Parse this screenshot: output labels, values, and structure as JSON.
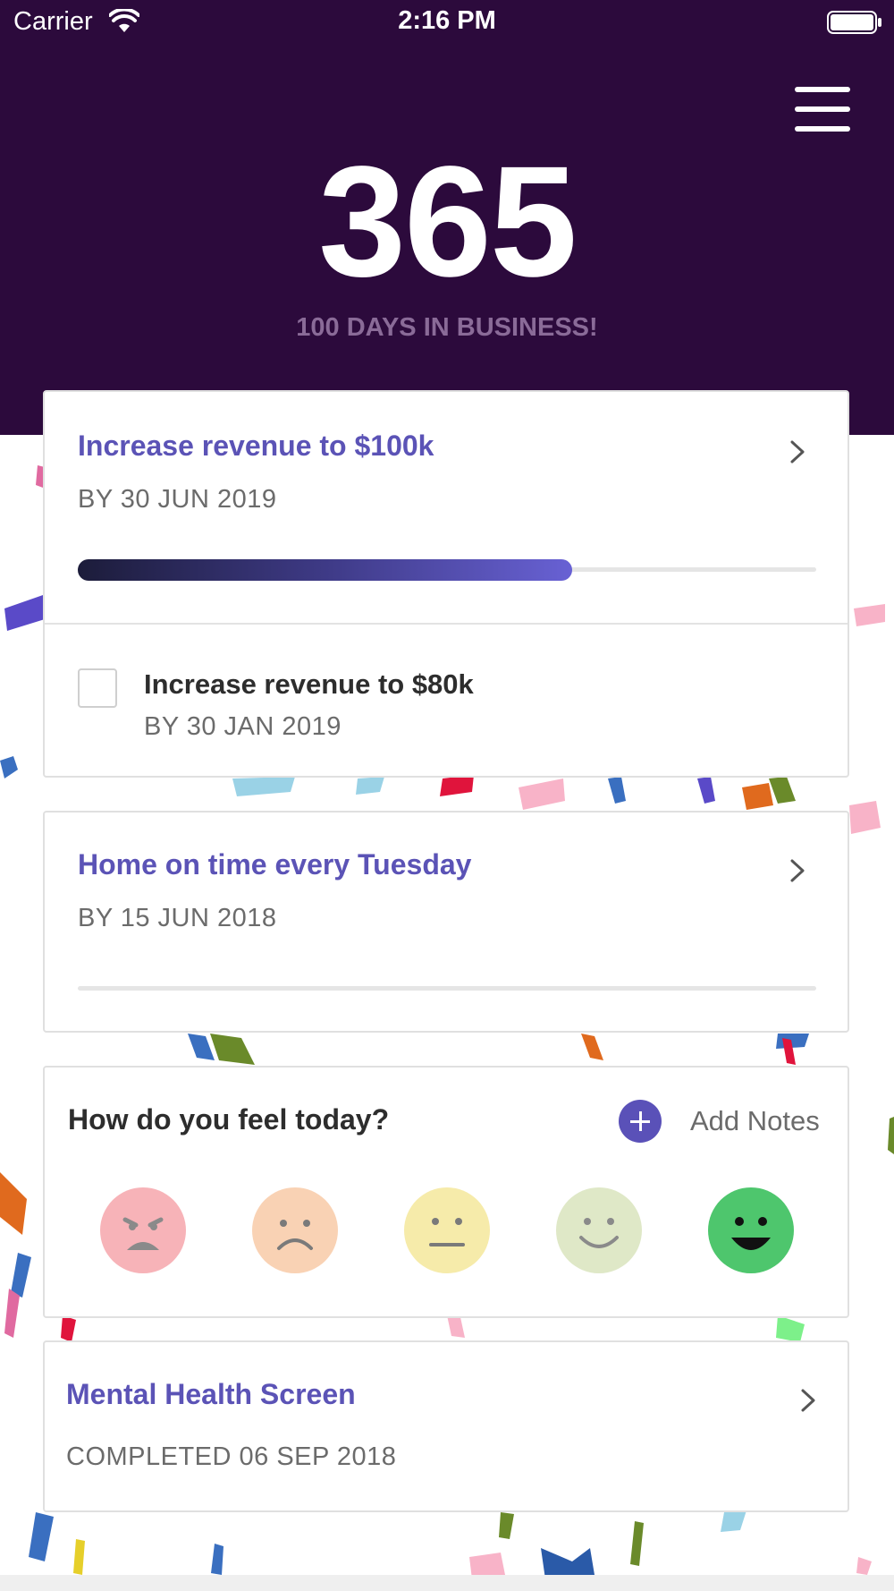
{
  "status_bar": {
    "carrier": "Carrier",
    "time": "2:16 PM"
  },
  "header": {
    "big_number": "365",
    "subtitle": "100 DAYS IN BUSINESS!",
    "background_color": "#2c0a3c"
  },
  "goals": [
    {
      "title": "Increase revenue to $100k",
      "date": "BY 30 JUN 2019",
      "progress_percent": 67,
      "subgoal": {
        "title": "Increase revenue to $80k",
        "date": "BY 30 JAN 2019",
        "checked": false
      }
    },
    {
      "title": "Home on time every Tuesday",
      "date": "BY 15 JUN 2018",
      "progress_percent": 0
    }
  ],
  "mood": {
    "question": "How do you feel today?",
    "add_notes_label": "Add Notes",
    "options": [
      "very-sad-face-icon",
      "sad-face-icon",
      "neutral-face-icon",
      "happy-face-icon",
      "very-happy-face-icon"
    ],
    "selected": "very-happy-face-icon"
  },
  "screening": {
    "title": "Mental Health Screen",
    "status": "COMPLETED 06 SEP 2018"
  },
  "colors": {
    "accent": "#5b53b6",
    "progress_dark": "#1c1c3a",
    "progress_light": "#6861d4",
    "selected_mood": "#4ec66d"
  }
}
